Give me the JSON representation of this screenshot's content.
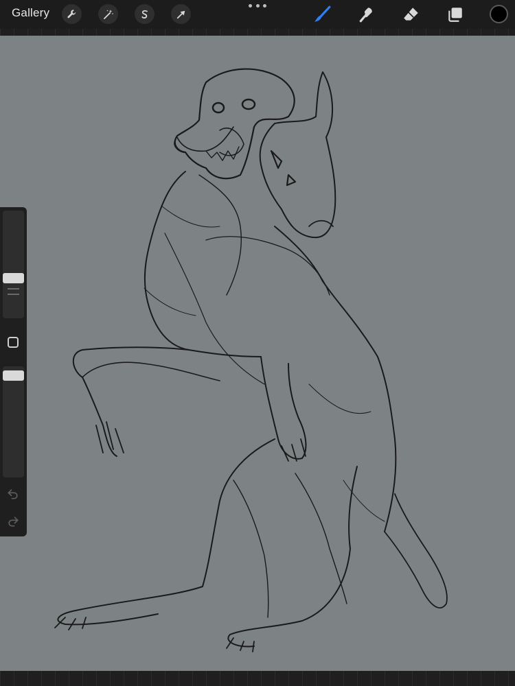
{
  "topbar": {
    "gallery_label": "Gallery",
    "left_tools": [
      {
        "name": "actions",
        "icon": "wrench-icon"
      },
      {
        "name": "adjustments",
        "icon": "magic-wand-icon"
      },
      {
        "name": "selection",
        "icon": "selection-s-icon"
      },
      {
        "name": "transform",
        "icon": "arrow-cursor-icon"
      }
    ],
    "right_tools": [
      {
        "name": "brush",
        "icon": "brush-icon",
        "active": true
      },
      {
        "name": "smudge",
        "icon": "smudge-icon"
      },
      {
        "name": "eraser",
        "icon": "eraser-icon"
      },
      {
        "name": "layers",
        "icon": "layers-icon"
      }
    ],
    "active_color": "#000000",
    "accent_color": "#2f7ff0"
  },
  "sidebar": {
    "brush_size_level": 0.62,
    "opacity_level": 0.9
  },
  "canvas": {
    "background": "#7d8384",
    "stroke_color": "#1a1a1a"
  }
}
